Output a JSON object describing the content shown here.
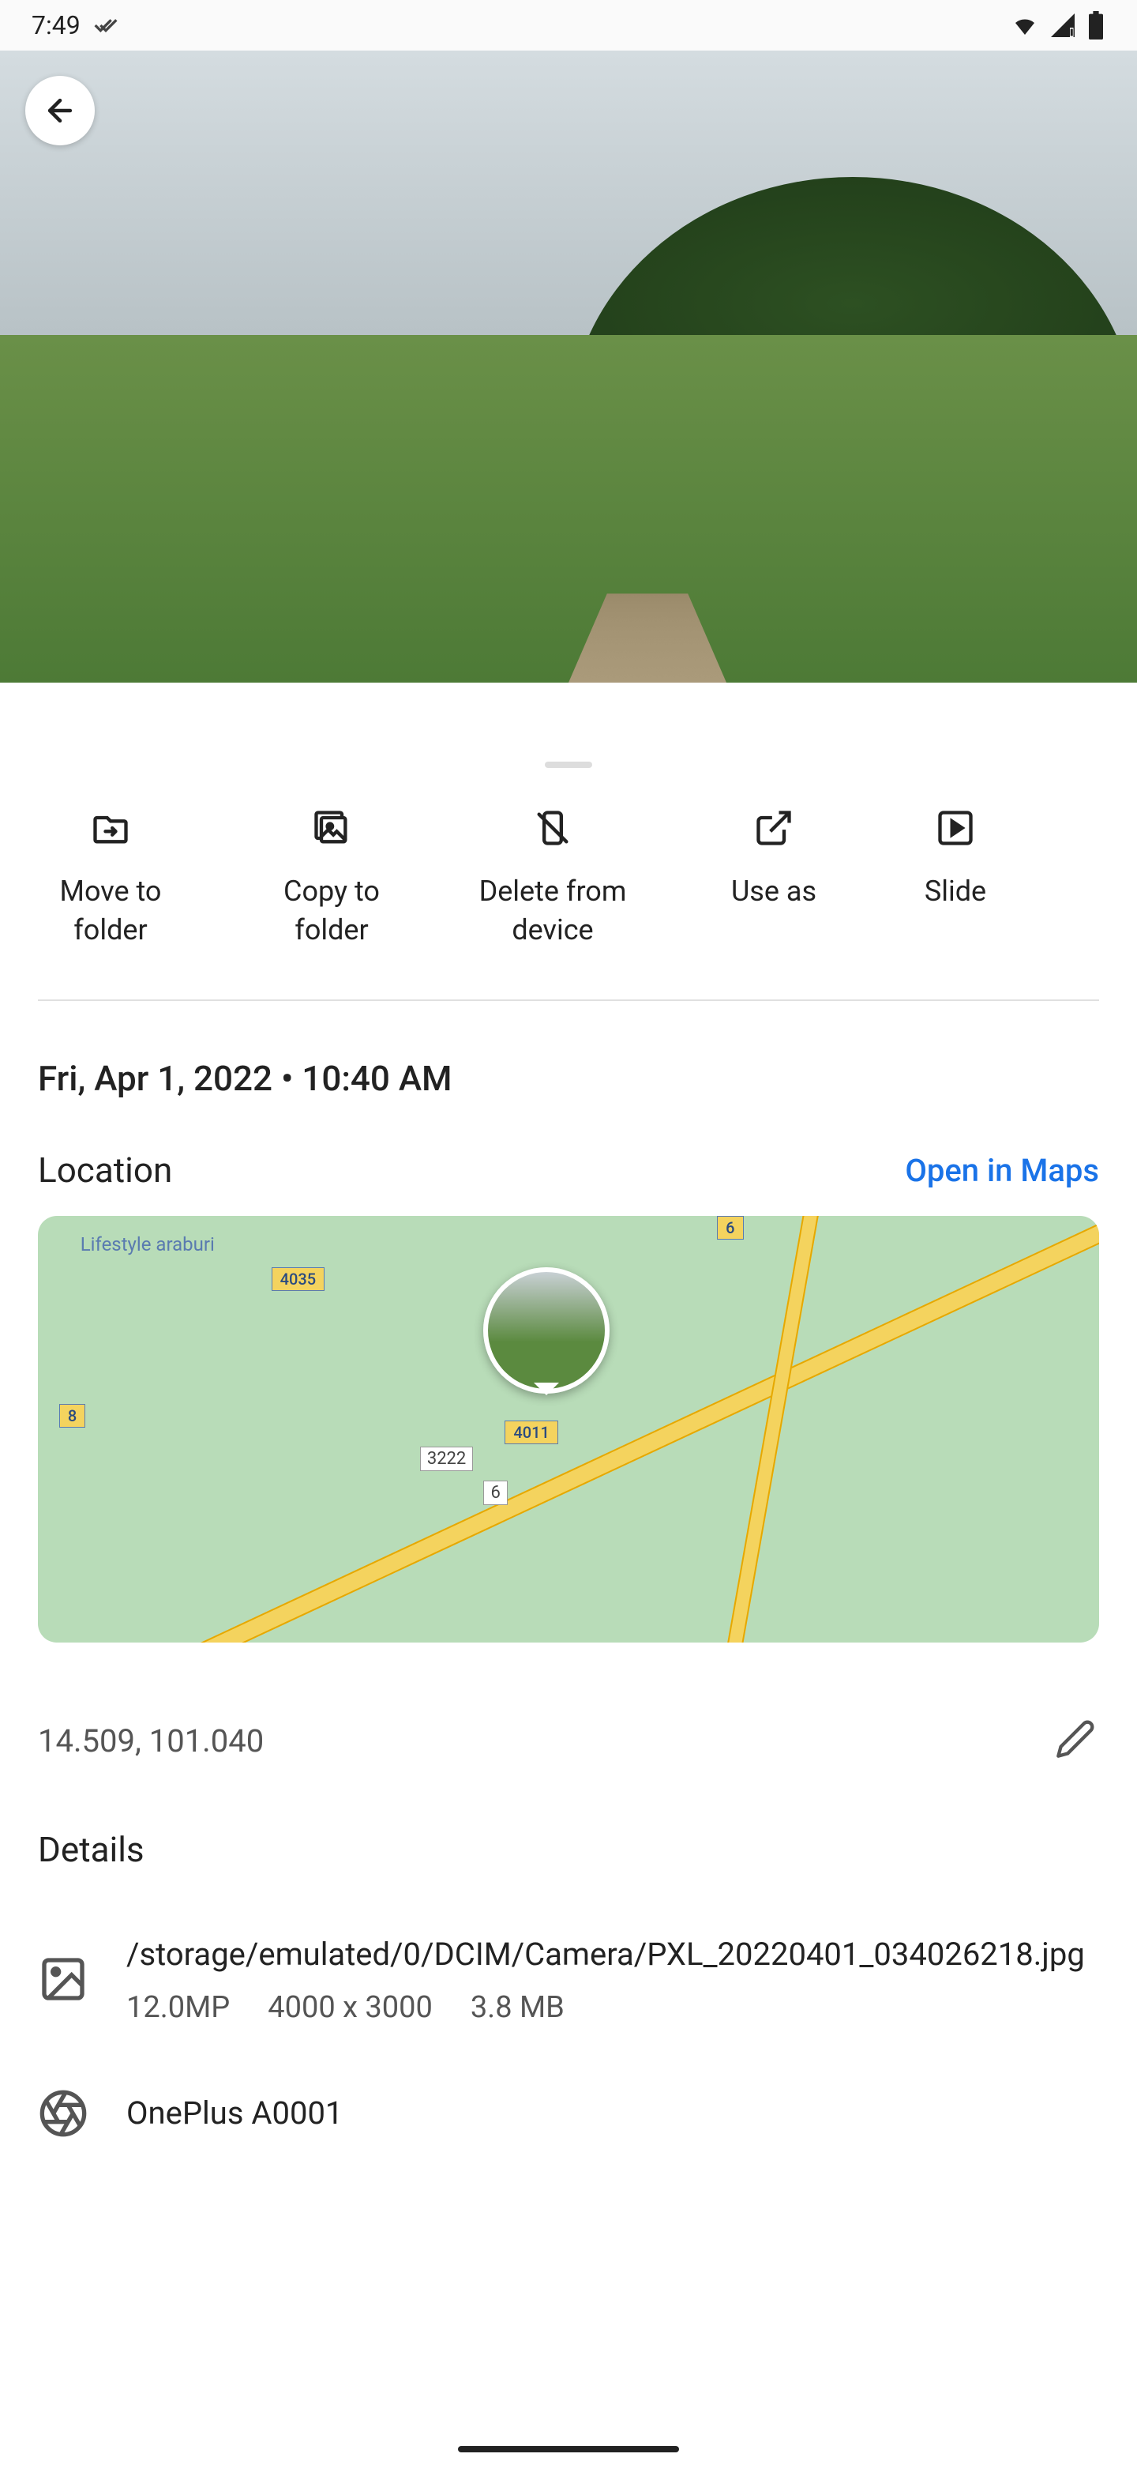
{
  "status": {
    "time": "7:49"
  },
  "actions": [
    {
      "name": "move-to-folder",
      "icon": "folder-move-icon",
      "label": "Move to\nfolder"
    },
    {
      "name": "copy-to-folder",
      "icon": "image-copy-icon",
      "label": "Copy to\nfolder"
    },
    {
      "name": "delete-from-device",
      "icon": "device-remove-icon",
      "label": "Delete from\ndevice"
    },
    {
      "name": "use-as",
      "icon": "open-external-icon",
      "label": "Use as"
    },
    {
      "name": "slideshow",
      "icon": "slideshow-icon",
      "label": "Slide"
    }
  ],
  "timestamp": "Fri, Apr 1, 2022  •  10:40 AM",
  "location": {
    "title": "Location",
    "open_label": "Open in Maps",
    "coords": "14.509, 101.040",
    "map_labels": {
      "poi": "Lifestyle\naraburi",
      "road_3222": "3222",
      "road_6": "6",
      "shield_4035": "4035",
      "shield_4011": "4011",
      "shield_8": "8",
      "shield_6_top": "6"
    }
  },
  "details": {
    "title": "Details",
    "file": {
      "path": "/storage/emulated/0/DCIM/Camera/PXL_20220401_034026218.jpg",
      "megapixels": "12.0MP",
      "dimensions": "4000 x 3000",
      "size": "3.8 MB"
    },
    "camera": {
      "model": "OnePlus A0001"
    }
  }
}
